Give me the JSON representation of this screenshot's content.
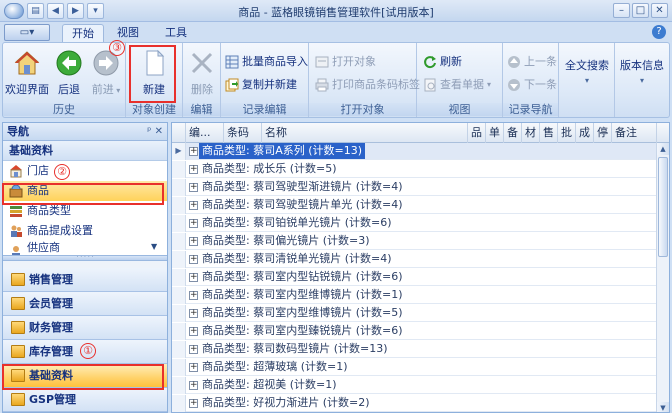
{
  "window": {
    "title": "商品 - 蓝格眼镜销售管理软件[试用版本]",
    "qat_icons": [
      "app-menu-icon",
      "layout-icon",
      "back-icon",
      "forward-icon",
      "dropdown-icon"
    ],
    "controls": [
      "minimize-icon",
      "maximize-icon",
      "close-icon"
    ]
  },
  "tabs": [
    {
      "label": "开始",
      "active": true
    },
    {
      "label": "视图",
      "active": false
    },
    {
      "label": "工具",
      "active": false
    }
  ],
  "ribbon": {
    "groups": {
      "history": "历史",
      "object_create": "对象创建",
      "edit": "编辑",
      "record_edit": "记录编辑",
      "print_object": "打开对象",
      "view": "视图",
      "record_nav": "记录导航"
    },
    "buttons": {
      "welcome": "欢迎界面",
      "back": "后退",
      "forward": "前进",
      "new": "新建",
      "delete": "删除",
      "batch_import": "批量商品导入",
      "copy_new": "复制并新建",
      "open_object": "打开对象",
      "print_barcode": "打印商品条码标签",
      "refresh": "刷新",
      "view_doc": "查看单据",
      "prev": "上一条",
      "next": "下一条",
      "fulltext_search": "全文搜索",
      "version_info": "版本信息"
    }
  },
  "annotations": {
    "n1": "①",
    "n2": "②",
    "n3": "③"
  },
  "nav": {
    "title": "导航",
    "header_btns": "ᵖ ✕",
    "section": "基础资料",
    "items": [
      {
        "label": "门店"
      },
      {
        "label": "商品",
        "selected": true
      },
      {
        "label": "商品类型"
      },
      {
        "label": "商品提成设置"
      },
      {
        "label": "供应商"
      }
    ],
    "modules": [
      {
        "label": "销售管理"
      },
      {
        "label": "会员管理"
      },
      {
        "label": "财务管理"
      },
      {
        "label": "库存管理"
      },
      {
        "label": "基础资料",
        "selected": true
      },
      {
        "label": "GSP管理"
      }
    ]
  },
  "grid": {
    "columns": [
      "编...",
      "条码",
      "名称",
      "品",
      "单",
      "备",
      "材",
      "售",
      "批",
      "成",
      "停",
      "备注"
    ],
    "rows": [
      "商品类型: 蔡司A系列 (计数=13)",
      "商品类型: 成长乐 (计数=5)",
      "商品类型: 蔡司驾驶型渐进镜片 (计数=4)",
      "商品类型: 蔡司驾驶型镜片单光 (计数=4)",
      "商品类型: 蔡司铂锐单光镜片 (计数=6)",
      "商品类型: 蔡司偏光镜片 (计数=3)",
      "商品类型: 蔡司清锐单光镜片 (计数=4)",
      "商品类型: 蔡司室内型钻锐镜片 (计数=6)",
      "商品类型: 蔡司室内型维博镜片 (计数=1)",
      "商品类型: 蔡司室内型维博镜片 (计数=5)",
      "商品类型: 蔡司室内型臻锐镜片 (计数=6)",
      "商品类型: 蔡司数码型镜片 (计数=13)",
      "商品类型: 超薄玻璃 (计数=1)",
      "商品类型: 超视美 (计数=1)",
      "商品类型: 好视力渐进片 (计数=2)"
    ]
  }
}
